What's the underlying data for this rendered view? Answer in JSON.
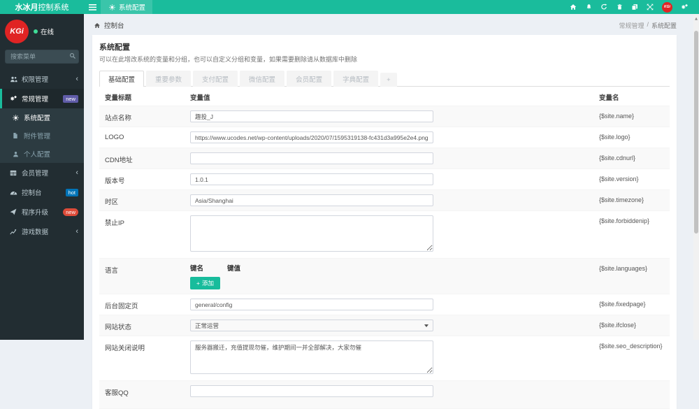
{
  "topbar": {
    "brand_bold": "水冰月",
    "brand_rest": "控制系统",
    "active_tab": "系统配置",
    "icons": [
      "home-icon",
      "bell-icon",
      "refresh-icon",
      "trash-icon",
      "copy-icon",
      "expand-icon",
      "avatar",
      "cogs-icon"
    ]
  },
  "sidebar": {
    "logo_text": "KGi",
    "online_status": "在线",
    "search_placeholder": "搜索菜单",
    "menu": [
      {
        "label": "权限管理",
        "icon": "users-icon"
      },
      {
        "label": "常规管理",
        "icon": "cogs-icon",
        "badge": "new"
      },
      {
        "label": "系统配置",
        "icon": "gear-icon"
      },
      {
        "label": "附件管理",
        "icon": "file-icon"
      },
      {
        "label": "个人配置",
        "icon": "user-icon"
      },
      {
        "label": "会员管理",
        "icon": "table-icon"
      },
      {
        "label": "控制台",
        "icon": "dashboard-icon",
        "badge": "hot"
      },
      {
        "label": "程序升级",
        "icon": "paper-plane-icon",
        "badge": "new"
      },
      {
        "label": "游戏数据",
        "icon": "chart-icon"
      }
    ]
  },
  "breadcrumb": {
    "section": "控制台",
    "parent": "常规管理",
    "separator": "/",
    "current": "系统配置"
  },
  "panel": {
    "title": "系统配置",
    "description": "可以在此增改系统的变量和分组，也可以自定义分组和变量，如果需要删除请从数据库中删除",
    "tabs": [
      "基础配置",
      "重要参数",
      "支付配置",
      "微信配置",
      "会员配置",
      "字典配置"
    ],
    "add_tab": "+"
  },
  "table": {
    "headers": [
      "变量标题",
      "变量值",
      "变量名"
    ],
    "add_icon": "+",
    "rows": [
      {
        "label": "站点名称",
        "value": "趣投_J",
        "varname": "{$site.name}"
      },
      {
        "label": "LOGO",
        "value": "https://www.ucodes.net/wp-content/uploads/2020/07/1595319138-fc431d3a995e2e4.png",
        "varname": "{$site.logo}"
      },
      {
        "label": "CDN地址",
        "value": "",
        "varname": "{$site.cdnurl}"
      },
      {
        "label": "版本号",
        "value": "1.0.1",
        "varname": "{$site.version}"
      },
      {
        "label": "时区",
        "value": "Asia/Shanghai",
        "varname": "{$site.timezone}"
      },
      {
        "label": "禁止IP",
        "value": "",
        "varname": "{$site.forbiddenip}"
      },
      {
        "label": "语言",
        "key_header": "键名",
        "value_header": "键值",
        "add_button": "添加",
        "varname": "{$site.languages}"
      },
      {
        "label": "后台固定页",
        "value": "general/config",
        "varname": "{$site.fixedpage}"
      },
      {
        "label": "网站状态",
        "value": "正常运营",
        "varname": "{$site.ifclose}"
      },
      {
        "label": "网站关闭说明",
        "value": "服务器搬迁，充值提现勿催，维护期间一并全部解决，大家勿催",
        "varname": "{$site.seo_description}"
      },
      {
        "label": "客服QQ",
        "value": "",
        "varname": ""
      }
    ]
  },
  "icons_text": {
    "chevron": "‹",
    "scroll_up": "▲"
  },
  "colors": {
    "accent": "#1abc9c",
    "sidebar_bg": "#222d32",
    "submenu_bg": "#2c3b41",
    "badge_new_purple": "#605ca8",
    "badge_hot_blue": "#0073b7",
    "badge_new_red": "#dd4b39",
    "logo_red": "#e02424",
    "content_bg": "#ecf0f5",
    "stripe": "#f9f9f9"
  }
}
